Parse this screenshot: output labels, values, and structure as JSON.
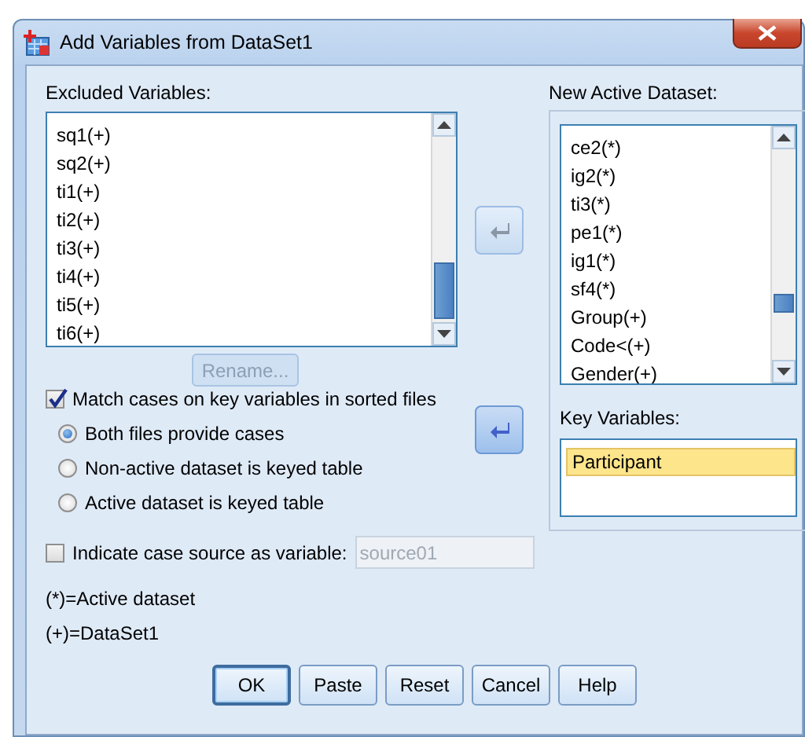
{
  "window": {
    "title": "Add Variables from DataSet1"
  },
  "excluded": {
    "label": "Excluded Variables:",
    "items": [
      {
        "label": "sq1(+)",
        "selected": false
      },
      {
        "label": "sq2(+)",
        "selected": false
      },
      {
        "label": "ti1(+)",
        "selected": false
      },
      {
        "label": "ti2(+)",
        "selected": false
      },
      {
        "label": "ti3(+)",
        "selected": false
      },
      {
        "label": "ti4(+)",
        "selected": false
      },
      {
        "label": "ti5(+)",
        "selected": false
      },
      {
        "label": "ti6(+)",
        "selected": false
      }
    ]
  },
  "rename_button": {
    "label": "Rename...",
    "disabled": true
  },
  "move_buttons": [
    {
      "disabled": true
    },
    {
      "disabled": false
    }
  ],
  "active": {
    "label": "New Active Dataset:",
    "items": [
      {
        "label": "ce2(*)",
        "selected": false
      },
      {
        "label": "ig2(*)",
        "selected": false
      },
      {
        "label": "ti3(*)",
        "selected": false
      },
      {
        "label": "pe1(*)",
        "selected": false
      },
      {
        "label": "ig1(*)",
        "selected": false
      },
      {
        "label": "sf4(*)",
        "selected": false
      },
      {
        "label": "Group(+)",
        "selected": false
      },
      {
        "label": "Code<(+)",
        "selected": false
      },
      {
        "label": "Gender(+)",
        "selected": false
      }
    ]
  },
  "match_cases": {
    "label": "Match cases on key variables in sorted files",
    "checked": true
  },
  "match_options": [
    {
      "label": "Both files provide cases",
      "selected": true
    },
    {
      "label": "Non-active dataset is keyed table",
      "selected": false
    },
    {
      "label": "Active dataset is keyed table",
      "selected": false
    }
  ],
  "key_variables": {
    "label": "Key Variables:",
    "items": [
      {
        "label": "Participant",
        "selected": true
      }
    ]
  },
  "indicate_source": {
    "label": "Indicate case source as variable:",
    "checked": false,
    "value": "source01",
    "disabled": true
  },
  "legend": [
    "(*)=Active dataset",
    "(+)=DataSet1"
  ],
  "buttons": [
    {
      "label": "OK",
      "kind": "default"
    },
    {
      "label": "Paste",
      "kind": "normal"
    },
    {
      "label": "Reset",
      "kind": "normal"
    },
    {
      "label": "Cancel",
      "kind": "normal"
    },
    {
      "label": "Help",
      "kind": "normal"
    }
  ]
}
